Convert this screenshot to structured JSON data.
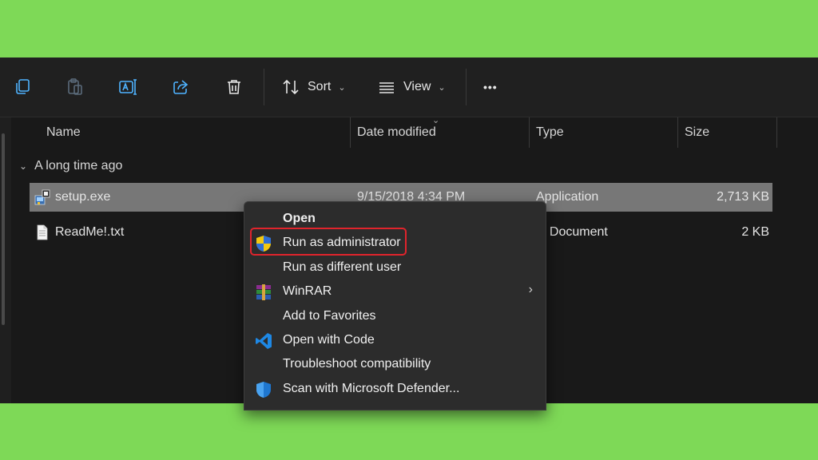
{
  "toolbar": {
    "sort_label": "Sort",
    "view_label": "View",
    "more_label": "•••"
  },
  "columns": {
    "name": "Name",
    "date": "Date modified",
    "type": "Type",
    "size": "Size"
  },
  "group": {
    "label": "A long time ago"
  },
  "files": [
    {
      "name": "setup.exe",
      "date": "9/15/2018 4:34 PM",
      "type": "Application",
      "size": "2,713 KB"
    },
    {
      "name": "ReadMe!.txt",
      "date": "",
      "type": "xt Document",
      "size": "2 KB"
    }
  ],
  "context_menu": {
    "items": [
      {
        "label": "Open"
      },
      {
        "label": "Run as administrator"
      },
      {
        "label": "Run as different user"
      },
      {
        "label": "WinRAR"
      },
      {
        "label": "Add to Favorites"
      },
      {
        "label": "Open with Code"
      },
      {
        "label": "Troubleshoot compatibility"
      },
      {
        "label": "Scan with Microsoft Defender..."
      }
    ]
  },
  "colors": {
    "page_background": "#7ed957",
    "explorer_background": "#191919",
    "selection": "#777777",
    "highlight_border": "#e0242c"
  }
}
